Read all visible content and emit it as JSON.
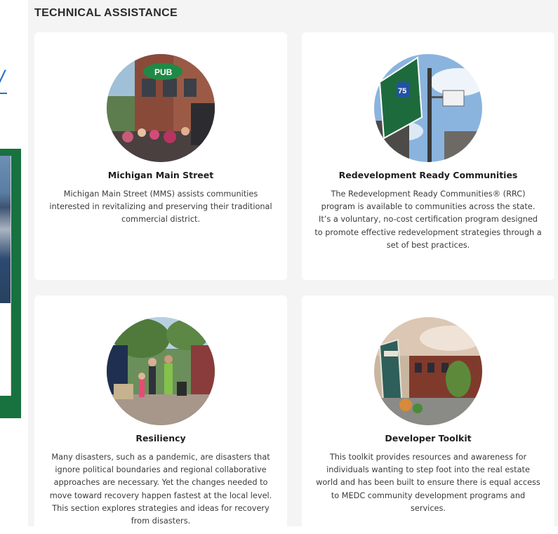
{
  "section": {
    "title": "TECHNICAL ASSISTANCE"
  },
  "cards": [
    {
      "title": "Michigan Main Street",
      "description": "Michigan Main Street (MMS) assists communities interested in revitalizing and preserving their traditional commercial district.",
      "image": "main-street-storefront-photo"
    },
    {
      "title": "Redevelopment Ready Communities",
      "description": "The Redevelopment Ready Communities® (RRC) program is available to communities across the state. It’s a voluntary, no-cost certification program designed to promote effective redevelopment strategies through a set of best practices.",
      "image": "highway-sign-bucket-truck-photo"
    },
    {
      "title": "Resiliency",
      "description": "Many disasters, such as a pandemic, are disasters that ignore political boundaries and regional collaborative approaches are necessary. Yet the changes needed to move toward recovery happen fastest at the local level. This section explores strategies and ideas for recovery from disasters.",
      "image": "downtown-sidewalk-family-photo"
    },
    {
      "title": "Developer Toolkit",
      "description": "This toolkit provides resources and awareness for individuals wanting to step foot into the real estate world and has been built to ensure there is equal access to MEDC community development programs and services.",
      "image": "depot-town-street-photo"
    }
  ],
  "colors": {
    "panel_background": "#f4f4f4",
    "card_background": "#ffffff",
    "promo_frame_green": "#17723f",
    "link_blue": "#2a6fc9"
  }
}
